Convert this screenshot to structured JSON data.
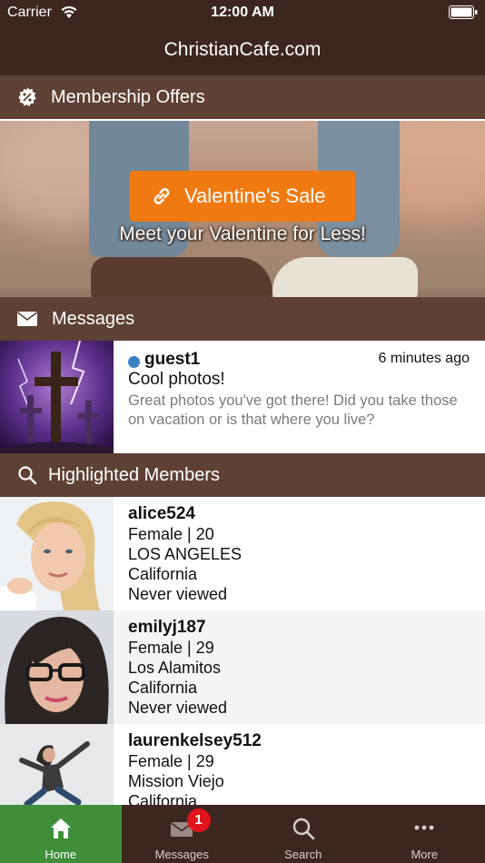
{
  "status_bar": {
    "carrier": "Carrier",
    "time": "12:00 AM"
  },
  "header": {
    "title": "ChristianCafe.com"
  },
  "sections": {
    "membership_offers": "Membership Offers",
    "messages": "Messages",
    "highlighted_members": "Highlighted Members"
  },
  "banner": {
    "button_label": "Valentine's Sale",
    "tagline": "Meet your Valentine for Less!"
  },
  "message": {
    "sender": "guest1",
    "time": "6 minutes ago",
    "subject": "Cool photos!",
    "preview": "Great photos you've got there! Did you take those on vacation or is that where you live?",
    "online_color": "#3b82c4"
  },
  "members": [
    {
      "username": "alice524",
      "details": "Female | 20",
      "city": "LOS ANGELES",
      "state": "California",
      "status": "Never viewed"
    },
    {
      "username": "emilyj187",
      "details": "Female | 29",
      "city": "Los Alamitos",
      "state": "California",
      "status": "Never viewed"
    },
    {
      "username": "laurenkelsey512",
      "details": "Female | 29",
      "city": "Mission Viejo",
      "state": "California",
      "status": ""
    }
  ],
  "tab_bar": {
    "items": [
      {
        "label": "Home",
        "icon": "home-icon",
        "active": true
      },
      {
        "label": "Messages",
        "icon": "envelope-icon",
        "badge": "1"
      },
      {
        "label": "Search",
        "icon": "search-icon"
      },
      {
        "label": "More",
        "icon": "more-dots-icon"
      }
    ]
  },
  "colors": {
    "header_bg": "#3d2620",
    "section_bg": "#5e4035",
    "accent_orange": "#f07a12",
    "active_tab": "#3f8f3a",
    "badge_red": "#e0141a"
  }
}
